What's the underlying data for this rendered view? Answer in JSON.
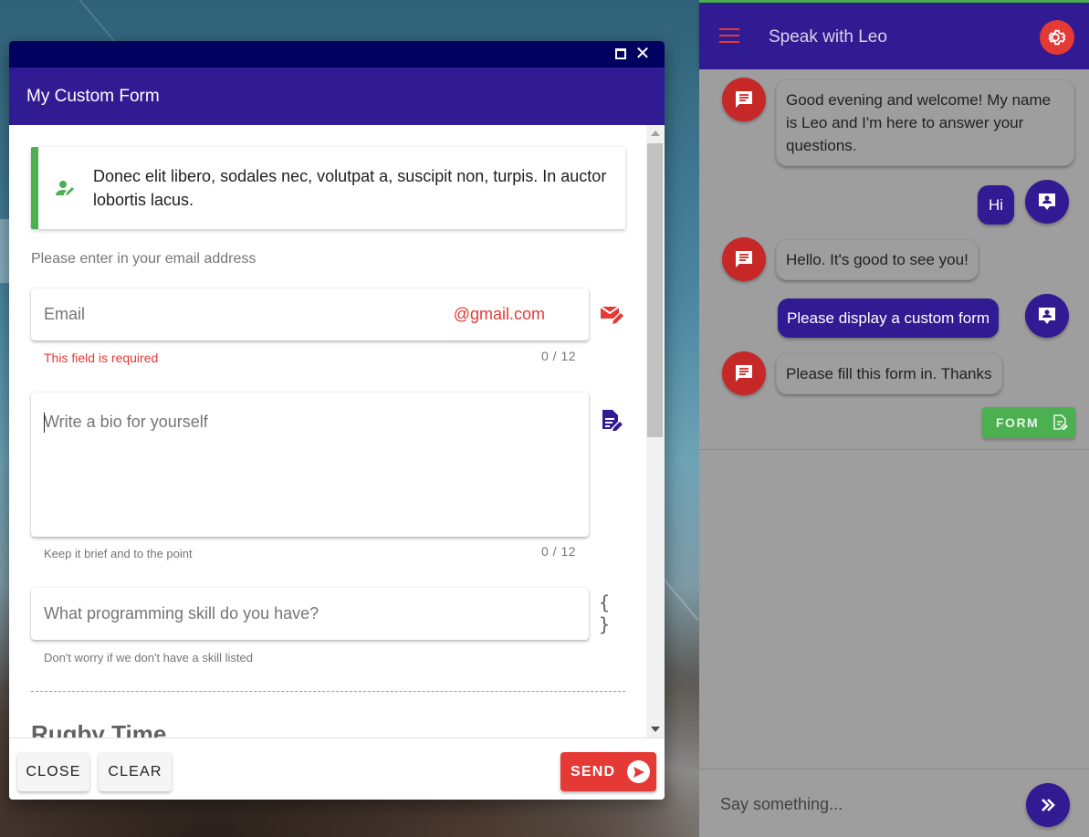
{
  "dialog": {
    "title": "My Custom Form",
    "banner_text": "Donec elit libero, sodales nec, volutpat a, suscipit non, turpis. In auctor lobortis lacus.",
    "email_hint": "Please enter in your email address",
    "email": {
      "placeholder": "Email",
      "suffix": "@gmail.com",
      "error": "This field is required",
      "counter": "0 / 12"
    },
    "bio": {
      "placeholder": "Write a bio for yourself",
      "help": "Keep it brief and to the point",
      "counter": "0 / 12"
    },
    "skill": {
      "placeholder": "What programming skill do you have?",
      "help": "Don't worry if we don't have a skill listed",
      "icon_text": "{ }"
    },
    "section_title": "Rugby Time",
    "buttons": {
      "close": "CLOSE",
      "clear": "CLEAR",
      "send": "SEND"
    }
  },
  "chat": {
    "title": "Speak with Leo",
    "messages": [
      {
        "from": "bot",
        "text": "Good evening and welcome! My name is Leo and I'm here to answer your questions."
      },
      {
        "from": "user",
        "text": "Hi"
      },
      {
        "from": "bot",
        "text": "Hello. It's good to see you!"
      },
      {
        "from": "user",
        "text": "Please display a custom form"
      },
      {
        "from": "bot",
        "text": "Please fill this form in. Thanks"
      }
    ],
    "form_chip": "FORM",
    "input_placeholder": "Say something..."
  },
  "colors": {
    "primary": "#311b92",
    "primary_dark": "#00005e",
    "accent_red": "#e53935",
    "success_green": "#4caf50",
    "chat_bg": "#9e9e9e"
  }
}
